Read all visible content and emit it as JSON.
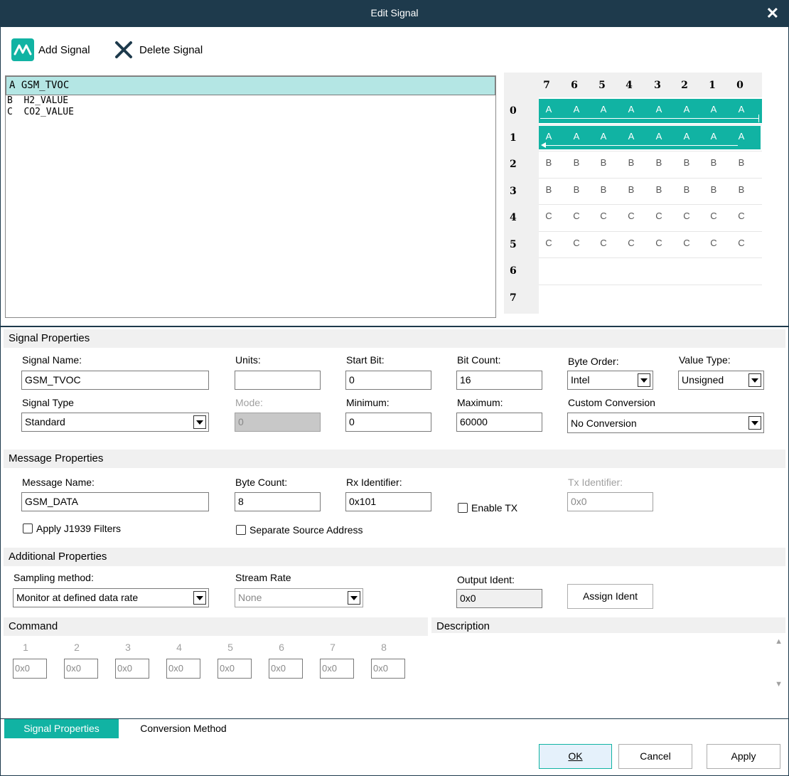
{
  "window": {
    "title": "Edit Signal"
  },
  "toolbar": {
    "add_label": "Add Signal",
    "delete_label": "Delete Signal"
  },
  "signals": [
    {
      "text": "A  GSM_TVOC"
    },
    {
      "text": "B  H2_VALUE"
    },
    {
      "text": "C  CO2_VALUE"
    }
  ],
  "bitgrid": {
    "columns": [
      "7",
      "6",
      "5",
      "4",
      "3",
      "2",
      "1",
      "0"
    ],
    "rows": [
      "0",
      "1",
      "2",
      "3",
      "4",
      "5",
      "6",
      "7"
    ],
    "cells": [
      [
        "A",
        "A",
        "A",
        "A",
        "A",
        "A",
        "A",
        "A"
      ],
      [
        "A",
        "A",
        "A",
        "A",
        "A",
        "A",
        "A",
        "A"
      ],
      [
        "B",
        "B",
        "B",
        "B",
        "B",
        "B",
        "B",
        "B"
      ],
      [
        "B",
        "B",
        "B",
        "B",
        "B",
        "B",
        "B",
        "B"
      ],
      [
        "C",
        "C",
        "C",
        "C",
        "C",
        "C",
        "C",
        "C"
      ],
      [
        "C",
        "C",
        "C",
        "C",
        "C",
        "C",
        "C",
        "C"
      ],
      [
        "",
        "",
        "",
        "",
        "",
        "",
        "",
        ""
      ],
      [
        "",
        "",
        "",
        "",
        "",
        "",
        "",
        ""
      ]
    ],
    "highlight_color": "#11b3a3"
  },
  "signal_props": {
    "header": "Signal Properties",
    "name_label": "Signal Name:",
    "name_value": "GSM_TVOC",
    "units_label": "Units:",
    "units_value": "",
    "startbit_label": "Start Bit:",
    "startbit_value": "0",
    "bitcount_label": "Bit Count:",
    "bitcount_value": "16",
    "byteorder_label": "Byte Order:",
    "byteorder_value": "Intel",
    "valuetype_label": "Value Type:",
    "valuetype_value": "Unsigned",
    "signaltype_label": "Signal Type",
    "signaltype_value": "Standard",
    "mode_label": "Mode:",
    "mode_value": "0",
    "minimum_label": "Minimum:",
    "minimum_value": "0",
    "maximum_label": "Maximum:",
    "maximum_value": "60000",
    "customconv_label": "Custom Conversion",
    "customconv_value": "No Conversion"
  },
  "message_props": {
    "header": "Message Properties",
    "name_label": "Message Name:",
    "name_value": "GSM_DATA",
    "bytecount_label": "Byte Count:",
    "bytecount_value": "8",
    "rxid_label": "Rx Identifier:",
    "rxid_value": "0x101",
    "enabletx_label": "Enable TX",
    "txid_label": "Tx Identifier:",
    "txid_value": "0x0",
    "j1939_label": "Apply J1939 Filters",
    "separate_label": "Separate Source Address"
  },
  "additional_props": {
    "header": "Additional Properties",
    "sampling_label": "Sampling method:",
    "sampling_value": "Monitor at defined data rate",
    "stream_label": "Stream Rate",
    "stream_value": "None",
    "outident_label": "Output Ident:",
    "outident_value": "0x0",
    "assign_label": "Assign Ident"
  },
  "command": {
    "header": "Command",
    "numbers": [
      "1",
      "2",
      "3",
      "4",
      "5",
      "6",
      "7",
      "8"
    ],
    "values": [
      "0x0",
      "0x0",
      "0x0",
      "0x0",
      "0x0",
      "0x0",
      "0x0",
      "0x0"
    ]
  },
  "description": {
    "header": "Description"
  },
  "tabs": {
    "signal_props": "Signal Properties",
    "conversion": "Conversion Method"
  },
  "buttons": {
    "ok": "OK",
    "cancel": "Cancel",
    "apply": "Apply"
  },
  "colors": {
    "titlebar": "#1e3a4c",
    "accent": "#11b3a3",
    "selection": "#b4e6e4"
  }
}
